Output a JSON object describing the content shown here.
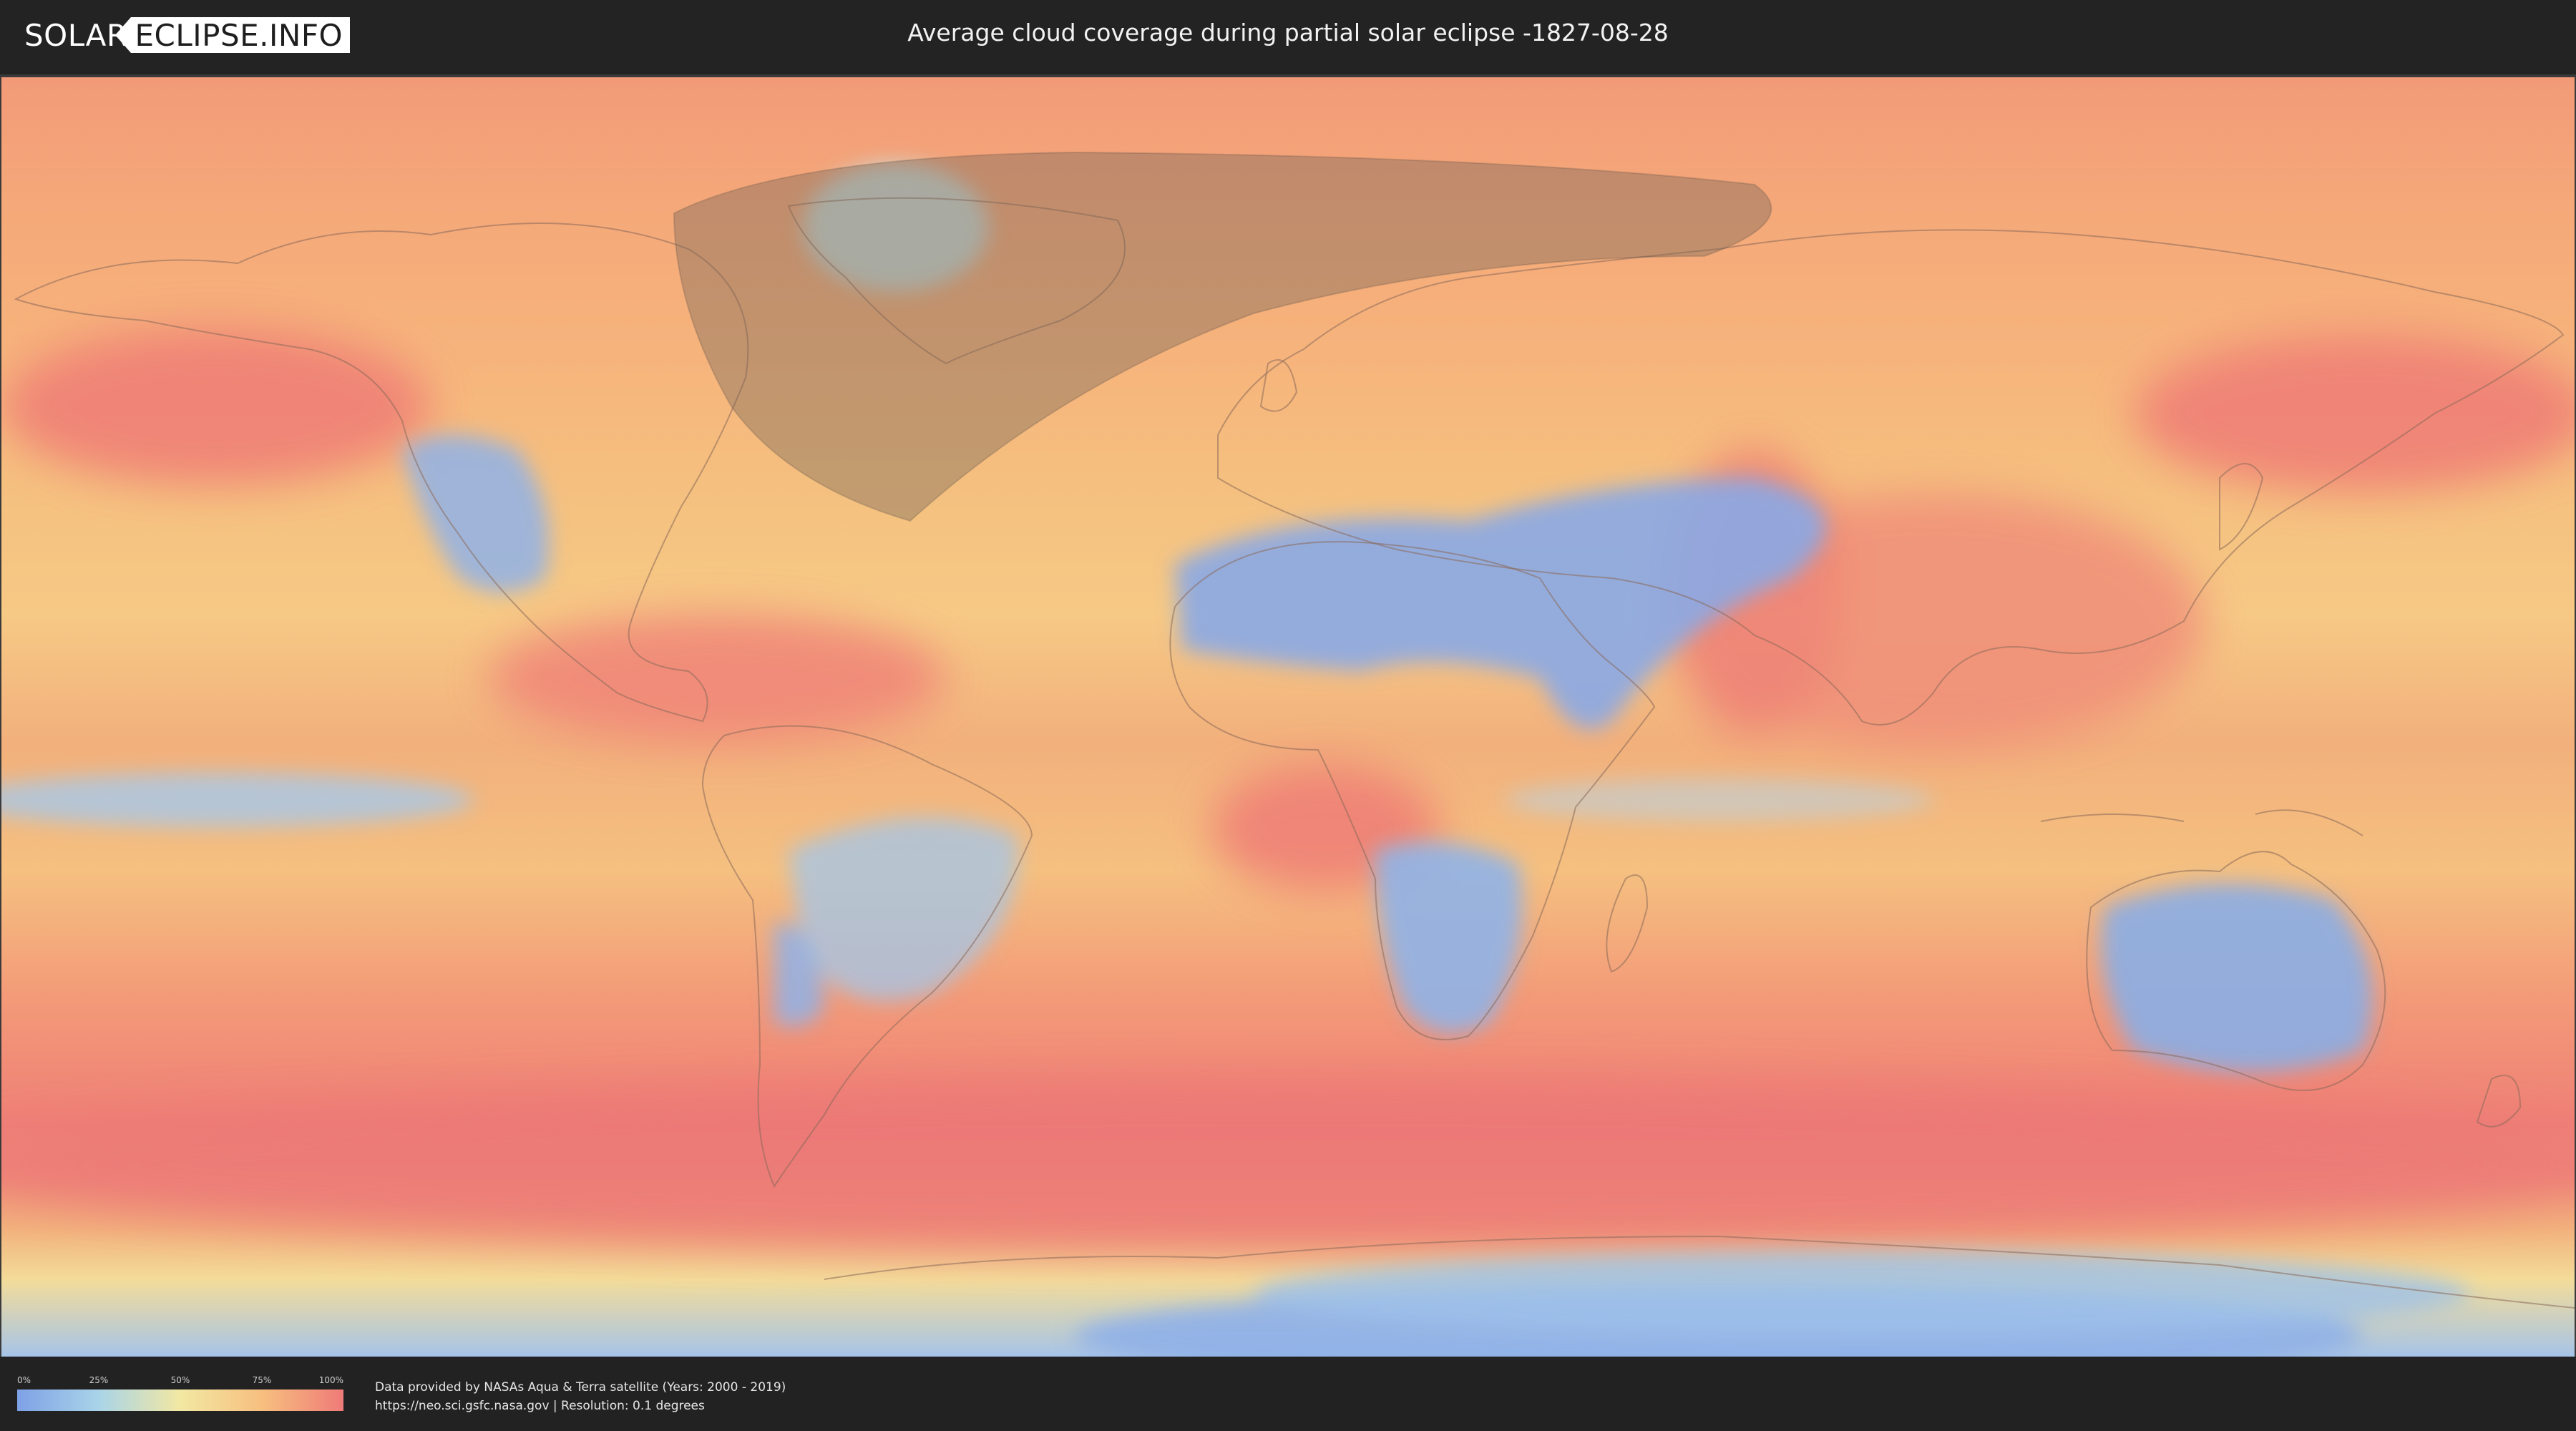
{
  "header": {
    "logo_left": "SOLAR",
    "logo_right": "ECLIPSE.INFO",
    "title": "Average cloud coverage during partial solar eclipse -1827-08-28"
  },
  "legend": {
    "ticks": [
      "0%",
      "25%",
      "50%",
      "75%",
      "100%"
    ],
    "colors": [
      "#7ea1e6",
      "#a9d4e8",
      "#f2e8a3",
      "#f7bf7f",
      "#ef7b78"
    ]
  },
  "credits": {
    "line1": "Data provided by NASAs Aqua & Terra satellite (Years: 2000 - 2019)",
    "line2": "https://neo.sci.gsfc.nasa.gov | Resolution: 0.1 degrees"
  }
}
